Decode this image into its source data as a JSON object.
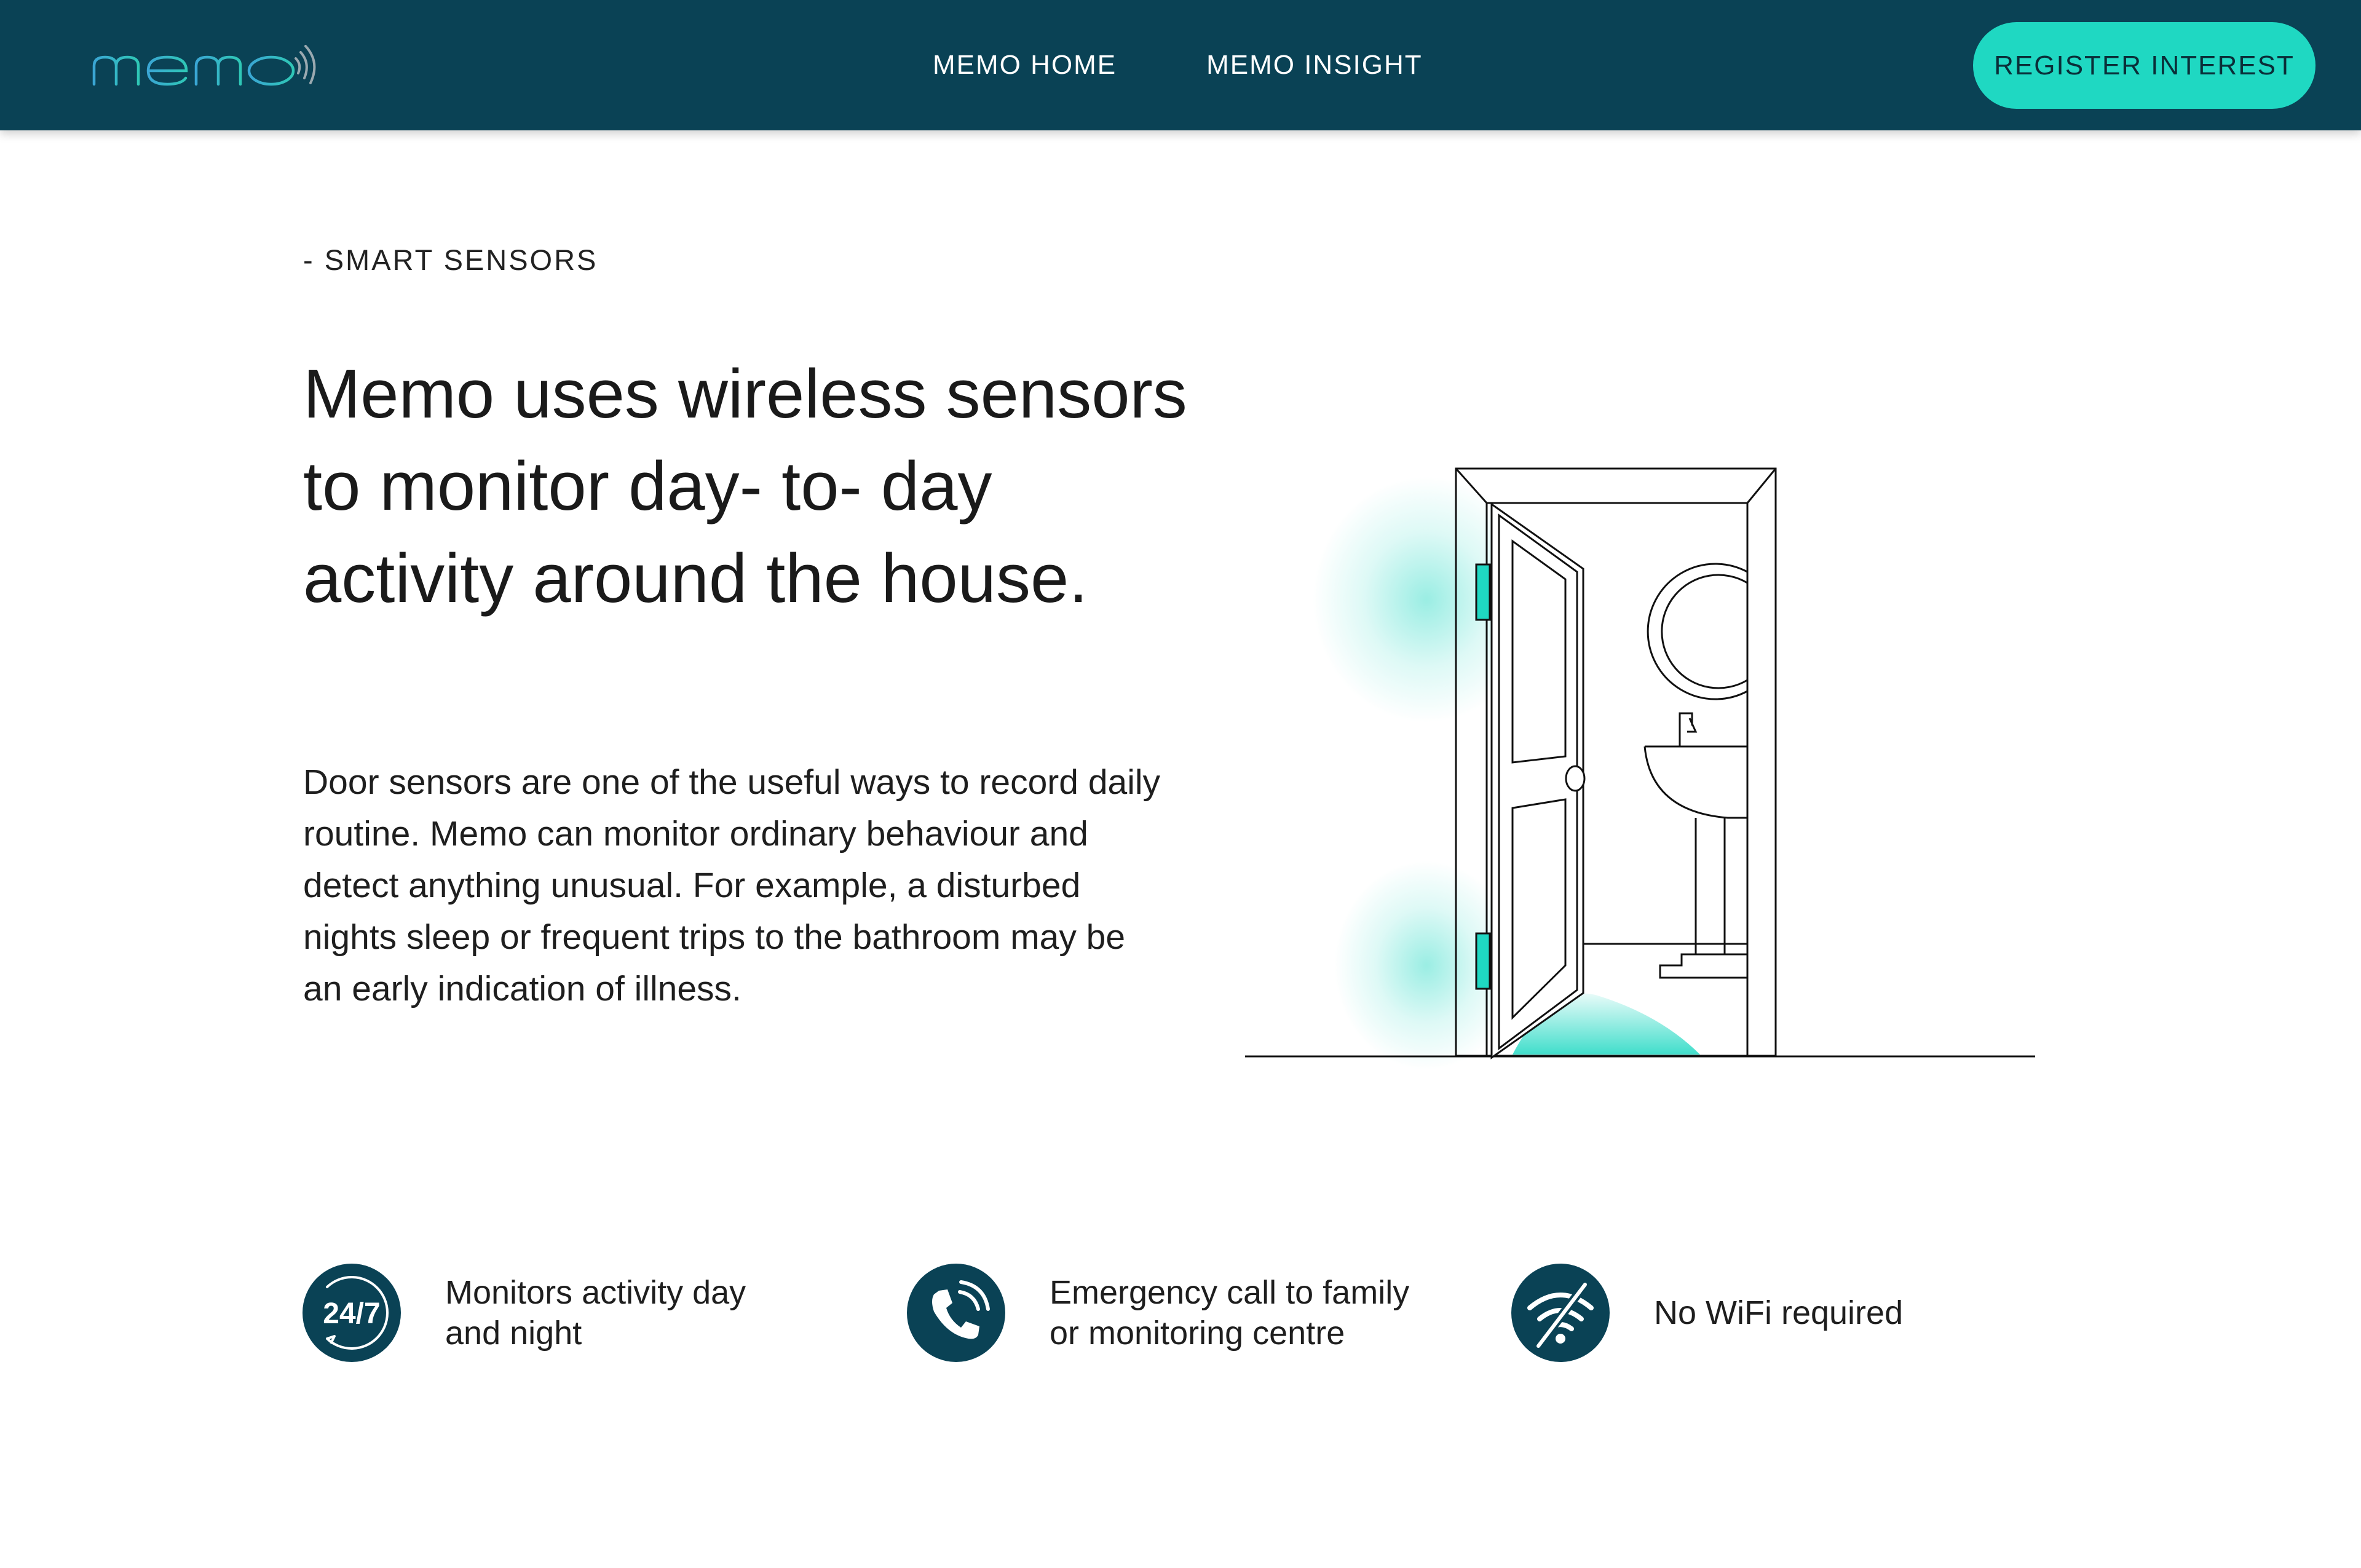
{
  "header": {
    "logo_text": "memo",
    "nav": [
      {
        "label": "MEMO HOME"
      },
      {
        "label": "MEMO INSIGHT"
      }
    ],
    "cta_label": "REGISTER INTEREST"
  },
  "section": {
    "eyebrow": "- SMART SENSORS",
    "headline": "Memo uses wireless sensors to monitor day- to- day activity around the house.",
    "body": "Door sensors are one of the useful ways to record daily routine. Memo can monitor ordinary behaviour and detect anything unusual. For example, a disturbed nights sleep or frequent trips to the bathroom may be an early indication of illness."
  },
  "features": [
    {
      "icon": "clock-24-7-icon",
      "icon_text": "24/7",
      "label": "Monitors activity day and night"
    },
    {
      "icon": "phone-call-icon",
      "label": "Emergency call to family or monitoring centre"
    },
    {
      "icon": "no-wifi-icon",
      "label": "No WiFi required"
    }
  ],
  "colors": {
    "header_bg": "#0a4255",
    "accent": "#1fd8c2",
    "logo": "#3aa6d4"
  }
}
